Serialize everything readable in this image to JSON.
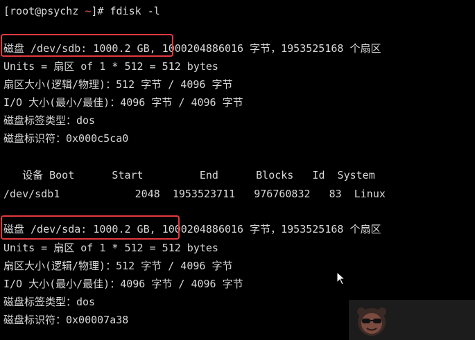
{
  "prompt": {
    "open_bracket": "[",
    "user_host": "root@psychz",
    "cwd": " ~",
    "close": "]# ",
    "command": "fdisk -l"
  },
  "disk1": {
    "header": "磁盘 /dev/sdb: 1000.2 GB",
    "header_rest": ", 1000204886016 字节，1953525168 个扇区",
    "units": "Units = 扇区 of 1 * 512 = 512 bytes",
    "sector_size": "扇区大小(逻辑/物理)：512 字节 / 4096 字节",
    "io_size": "I/O 大小(最小/最佳)：4096 字节 / 4096 字节",
    "label_type": "磁盘标签类型：dos",
    "identifier": "磁盘标识符：0x000c5ca0"
  },
  "partition_table": {
    "header": "   设备 Boot      Start         End      Blocks   Id  System",
    "rows": [
      "/dev/sdb1            2048  1953523711   976760832   83  Linux"
    ]
  },
  "disk2": {
    "header": "磁盘 /dev/sda: 1000.2 GB,",
    "header_rest": " 1000204886016 字节，1953525168 个扇区",
    "units": "Units = 扇区 of 1 * 512 = 512 bytes",
    "sector_size": "扇区大小(逻辑/物理)：512 字节 / 4096 字节",
    "io_size": "I/O 大小(最小/最佳)：4096 字节 / 4096 字节",
    "label_type": "磁盘标签类型：dos",
    "identifier": "磁盘标识符：0x00007a38"
  },
  "colors": {
    "background": "#000000",
    "text": "#d8d8d8",
    "highlight_box": "#e3393f",
    "tilde": "#c0504d"
  }
}
